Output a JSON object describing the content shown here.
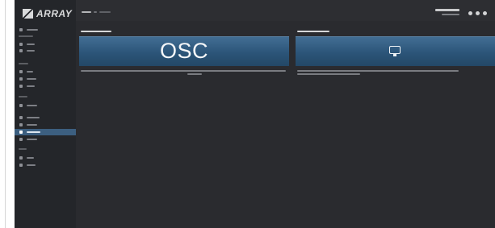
{
  "app": {
    "logo_text": "ARRAY",
    "accent_color": "#3c5f80",
    "card_color": "#2c5579"
  },
  "sidebar": {
    "logo_icon": "array-logo-mark",
    "active_item_index": 11,
    "items": [
      {
        "icon": "dashboard-icon"
      },
      {
        "icon": "gear-icon"
      },
      {
        "icon": "gear-icon"
      },
      {
        "icon": "network-icon"
      },
      {
        "icon": "shield-icon"
      },
      {
        "icon": "link-icon"
      },
      {
        "icon": "users-icon"
      },
      {
        "icon": "eye-icon"
      },
      {
        "icon": "pencil-icon"
      },
      {
        "icon": "settings-icon"
      },
      {
        "icon": "settings-icon"
      },
      {
        "icon": "monitor-icon"
      },
      {
        "icon": "user-icon"
      },
      {
        "icon": "logout-icon"
      }
    ]
  },
  "topbar": {
    "icons": [
      "user-icon",
      "help-icon",
      "power-icon"
    ]
  },
  "panels": [
    {
      "card_text": "OSC",
      "card_icon": ""
    },
    {
      "card_text": "",
      "card_icon": "monitor-icon"
    }
  ]
}
